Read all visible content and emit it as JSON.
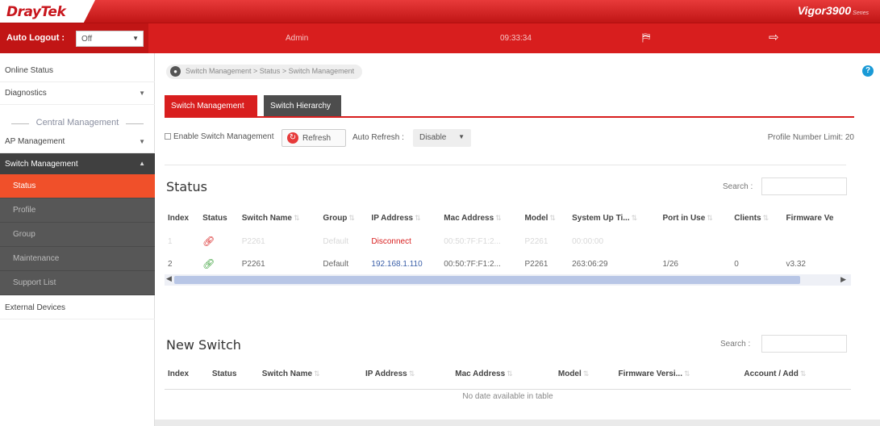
{
  "brand": {
    "logo": "DrayTek",
    "product": "Vigor3900",
    "product_suffix": "Series"
  },
  "topbar": {
    "auto_logout_label": "Auto Logout :",
    "auto_logout_value": "Off",
    "user": "Admin",
    "time": "09:33:34"
  },
  "sidebar": {
    "online_status": "Online Status",
    "diagnostics": "Diagnostics",
    "group_label": "Central Management",
    "ap_management": "AP Management",
    "switch_management": "Switch Management",
    "sub_items": [
      "Status",
      "Profile",
      "Group",
      "Maintenance",
      "Support List"
    ],
    "external_devices": "External Devices"
  },
  "breadcrumb": "Switch Management > Status > Switch Management",
  "tabs": [
    "Switch Management",
    "Switch Hierarchy"
  ],
  "toolbar": {
    "enable_label": "Enable Switch Management",
    "refresh_label": "Refresh",
    "auto_refresh_label": "Auto Refresh :",
    "auto_refresh_value": "Disable",
    "profile_limit": "Profile Number Limit: 20"
  },
  "status_section": {
    "title": "Status",
    "search_label": "Search :",
    "columns": [
      "Index",
      "Status",
      "Switch Name",
      "Group",
      "IP Address",
      "Mac Address",
      "Model",
      "System Up Ti...",
      "Port in Use",
      "Clients",
      "Firmware Ve"
    ],
    "rows": [
      {
        "index": "1",
        "switch_name": "P2261",
        "group": "Default",
        "ip": "Disconnect",
        "mac": "00:50:7F:F1:2...",
        "model": "P2261",
        "uptime": "00:00:00",
        "port": "",
        "clients": "",
        "firmware": ""
      },
      {
        "index": "2",
        "switch_name": "P2261",
        "group": "Default",
        "ip": "192.168.1.110",
        "mac": "00:50:7F:F1:2...",
        "model": "P2261",
        "uptime": "263:06:29",
        "port": "1/26",
        "clients": "0",
        "firmware": "v3.32"
      }
    ]
  },
  "new_switch_section": {
    "title": "New Switch",
    "search_label": "Search :",
    "columns": [
      "Index",
      "Status",
      "Switch Name",
      "IP Address",
      "Mac Address",
      "Model",
      "Firmware Versi...",
      "Account / Add"
    ],
    "empty_text": "No date available in table"
  }
}
